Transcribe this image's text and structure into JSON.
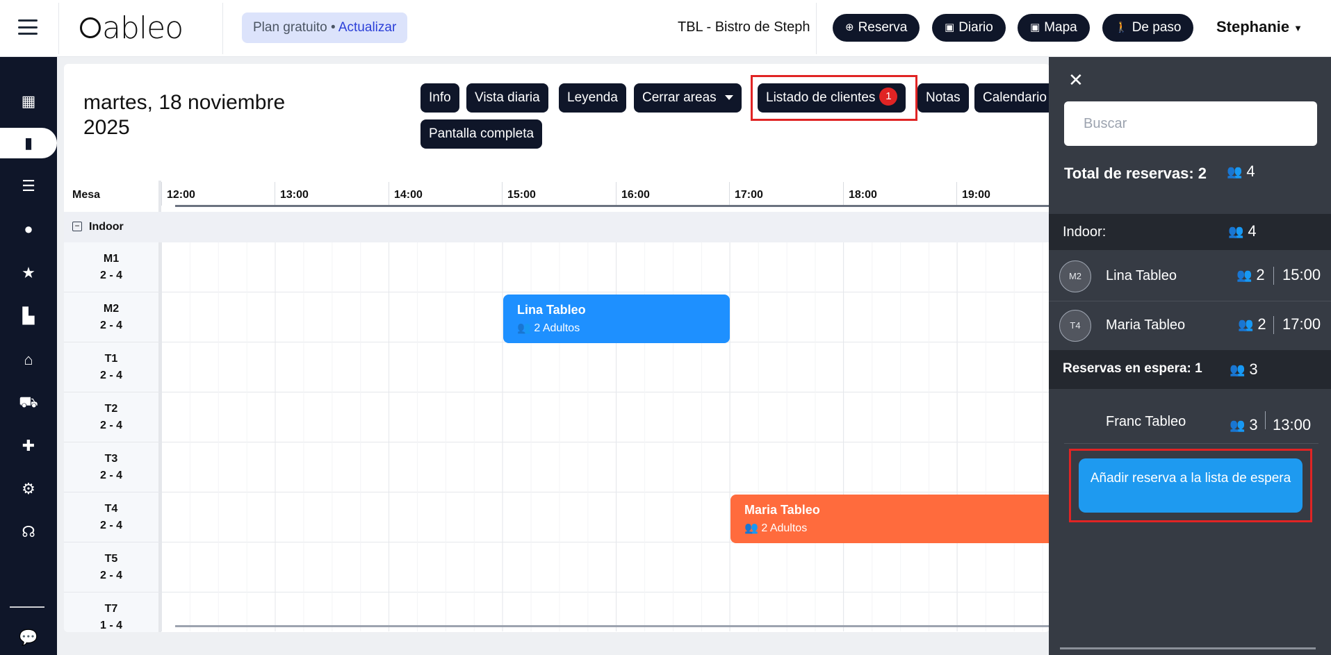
{
  "topbar": {
    "logo": "tableo",
    "plan_text": "Plan gratuito •",
    "plan_upgrade": "Actualizar",
    "restaurant": "TBL - Bistro de Steph",
    "buttons": [
      "Reserva",
      "Diario",
      "Mapa",
      "De paso"
    ],
    "user": "Stephanie"
  },
  "sidebar": {
    "icons": [
      "dashboard-icon",
      "book-icon",
      "list-icon",
      "user-icon",
      "star-icon",
      "chart-icon",
      "bell-icon",
      "cart-icon",
      "puzzle-icon",
      "gear-icon",
      "headset-icon",
      "chat-icon"
    ],
    "active_index": 1
  },
  "main": {
    "date": "martes, 18 noviembre 2025",
    "toolbar": {
      "info": "Info",
      "daily_view": "Vista diaria",
      "legend": "Leyenda",
      "close_areas": "Cerrar areas",
      "client_list": "Listado de clientes",
      "client_list_badge": "1",
      "notes": "Notas",
      "calendar": "Calendario",
      "fullscreen": "Pantalla completa"
    },
    "timeline": {
      "mesa_header": "Mesa",
      "hours": [
        "12:00",
        "13:00",
        "14:00",
        "15:00",
        "16:00",
        "17:00",
        "18:00",
        "19:00"
      ],
      "area": "Indoor",
      "tables": [
        {
          "name": "M1",
          "cap": "2 - 4"
        },
        {
          "name": "M2",
          "cap": "2 - 4"
        },
        {
          "name": "T1",
          "cap": "2 - 4"
        },
        {
          "name": "T2",
          "cap": "2 - 4"
        },
        {
          "name": "T3",
          "cap": "2 - 4"
        },
        {
          "name": "T4",
          "cap": "2 - 4"
        },
        {
          "name": "T5",
          "cap": "2 - 4"
        },
        {
          "name": "T7",
          "cap": "1 - 4"
        }
      ],
      "bookings": [
        {
          "name": "Lina Tableo",
          "guests": "2 Adultos",
          "color": "#1e90ff"
        },
        {
          "name": "Maria Tableo",
          "guests": "2 Adultos",
          "color": "#ff6b3d"
        }
      ]
    }
  },
  "panel": {
    "search_placeholder": "Buscar",
    "total_label": "Total de reservas: 2",
    "total_people": "4",
    "area_label": "Indoor:",
    "area_people": "4",
    "reservations": [
      {
        "table": "M2",
        "name": "Lina Tableo",
        "people": "2",
        "time": "15:00"
      },
      {
        "table": "T4",
        "name": "Maria Tableo",
        "people": "2",
        "time": "17:00"
      }
    ],
    "waiting_label": "Reservas en espera: 1",
    "waiting_people": "3",
    "waiting": [
      {
        "name": "Franc Tableo",
        "people": "3",
        "time": "13:00"
      }
    ],
    "add_waitlist": "Añadir reserva a la lista de espera"
  },
  "colors": {
    "navy": "#0f1629",
    "lina_booking": "#1e90ff",
    "maria_booking": "#ff6b3d",
    "badge": "#e02424",
    "panel_bg": "#363b44",
    "waitlist_button": "#1e9af0"
  }
}
